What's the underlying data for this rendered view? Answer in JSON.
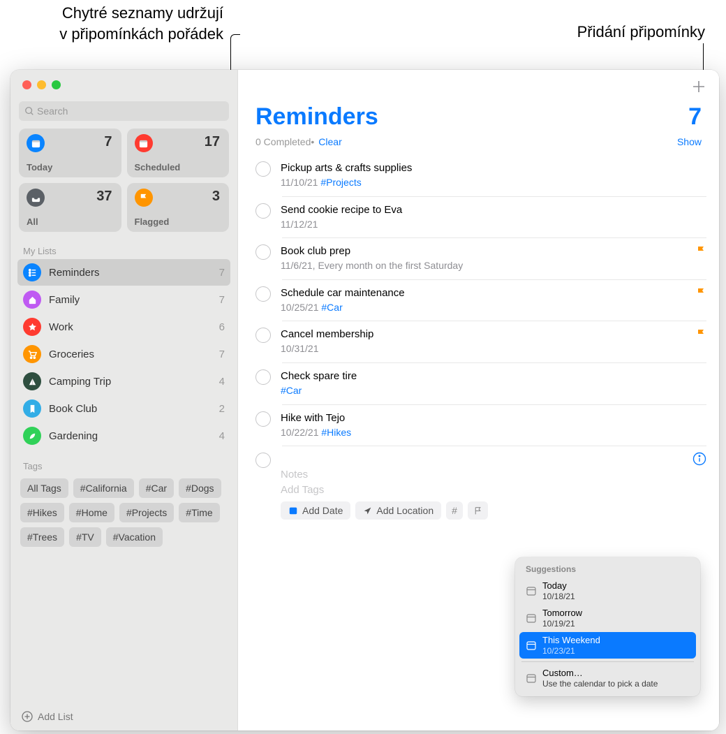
{
  "annotations": {
    "left_line1": "Chytré seznamy udržují",
    "left_line2": "v připomínkách pořádek",
    "right": "Přidání připomínky"
  },
  "search_placeholder": "Search",
  "smart": [
    {
      "label": "Today",
      "count": "7",
      "color": "blue",
      "icon": "calendar"
    },
    {
      "label": "Scheduled",
      "count": "17",
      "color": "red",
      "icon": "calendar"
    },
    {
      "label": "All",
      "count": "37",
      "color": "gray",
      "icon": "tray"
    },
    {
      "label": "Flagged",
      "count": "3",
      "color": "orange",
      "icon": "flag"
    }
  ],
  "mylists_header": "My Lists",
  "lists": [
    {
      "name": "Reminders",
      "count": "7",
      "color": "c-blue",
      "icon": "list"
    },
    {
      "name": "Family",
      "count": "7",
      "color": "c-purple",
      "icon": "home"
    },
    {
      "name": "Work",
      "count": "6",
      "color": "c-red",
      "icon": "star"
    },
    {
      "name": "Groceries",
      "count": "7",
      "color": "c-orange",
      "icon": "cart"
    },
    {
      "name": "Camping Trip",
      "count": "4",
      "color": "c-darkgreen",
      "icon": "tent"
    },
    {
      "name": "Book Club",
      "count": "2",
      "color": "c-lblue",
      "icon": "bookmark"
    },
    {
      "name": "Gardening",
      "count": "4",
      "color": "c-green",
      "icon": "leaf"
    }
  ],
  "tags_header": "Tags",
  "tags": [
    "All Tags",
    "#California",
    "#Car",
    "#Dogs",
    "#Hikes",
    "#Home",
    "#Projects",
    "#Time",
    "#Trees",
    "#TV",
    "#Vacation"
  ],
  "addlist": "Add List",
  "main": {
    "title": "Reminders",
    "count": "7",
    "completed": "0 Completed",
    "dot": " • ",
    "clear": "Clear",
    "show": "Show"
  },
  "items": [
    {
      "title": "Pickup arts & crafts supplies",
      "date": "11/10/21",
      "tag": "#Projects",
      "flag": false
    },
    {
      "title": "Send cookie recipe to Eva",
      "date": "11/12/21",
      "tag": "",
      "flag": false
    },
    {
      "title": "Book club prep",
      "date": "11/6/21, Every month on the first Saturday",
      "tag": "",
      "flag": true
    },
    {
      "title": "Schedule car maintenance",
      "date": "10/25/21",
      "tag": "#Car",
      "flag": true
    },
    {
      "title": "Cancel membership",
      "date": "10/31/21",
      "tag": "",
      "flag": true
    },
    {
      "title": "Check spare tire",
      "date": "",
      "tag": "#Car",
      "flag": false
    },
    {
      "title": "Hike with Tejo",
      "date": "10/22/21",
      "tag": "#Hikes",
      "flag": false
    }
  ],
  "newitem": {
    "notes_ph": "Notes",
    "tags_ph": "Add Tags",
    "add_date": "Add Date",
    "add_location": "Add Location"
  },
  "sugg": {
    "header": "Suggestions",
    "items": [
      {
        "t1": "Today",
        "t2": "10/18/21",
        "sel": false
      },
      {
        "t1": "Tomorrow",
        "t2": "10/19/21",
        "sel": false
      },
      {
        "t1": "This Weekend",
        "t2": "10/23/21",
        "sel": true
      }
    ],
    "custom": {
      "t1": "Custom…",
      "t2": "Use the calendar to pick a date"
    }
  }
}
